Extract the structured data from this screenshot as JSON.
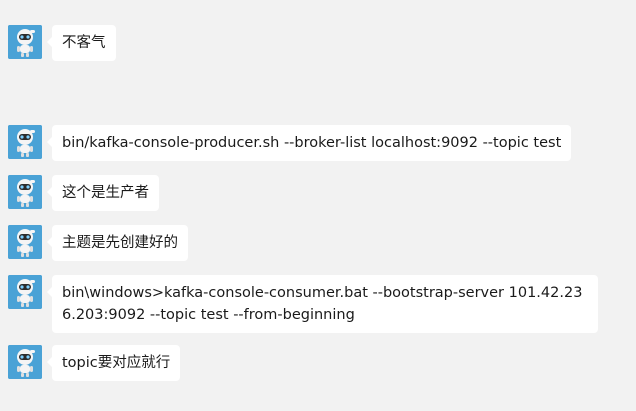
{
  "messages": [
    {
      "text": "不客气"
    },
    {
      "text": "bin/kafka-console-producer.sh --broker-list localhost:9092 --topic test"
    },
    {
      "text": "这个是生产者"
    },
    {
      "text": "主题是先创建好的"
    },
    {
      "text": "bin\\windows>kafka-console-consumer.bat --bootstrap-server 101.42.236.203:9092 --topic test --from-beginning"
    },
    {
      "text": "topic要对应就行"
    }
  ],
  "colors": {
    "background": "#f2f2f2",
    "bubble": "#ffffff",
    "avatar_bg": "#4aa2d6"
  },
  "icons": {
    "avatar": "robot-avatar-icon"
  }
}
